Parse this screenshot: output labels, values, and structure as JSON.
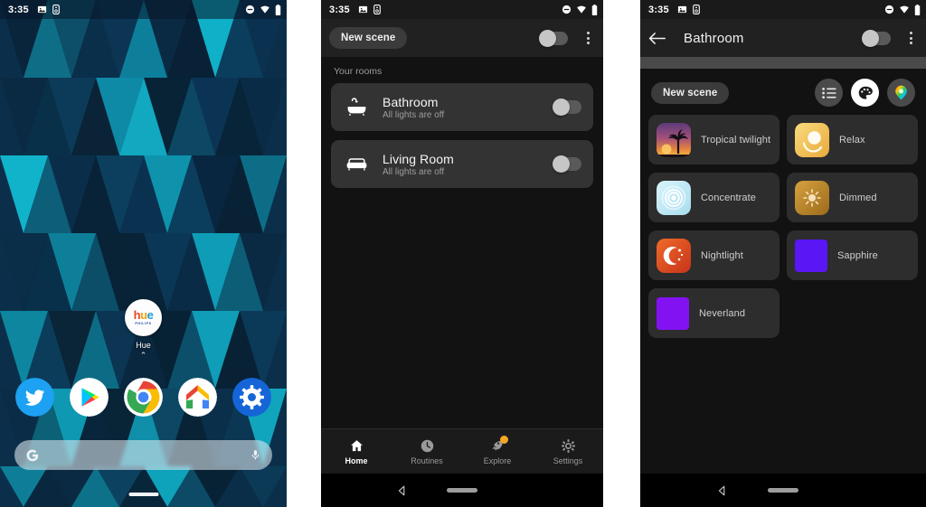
{
  "phones": {
    "launcher": {
      "status": {
        "time": "3:35",
        "left_icons": [
          "image-icon",
          "usb-debug-icon"
        ],
        "right_icons": [
          "do-not-disturb-icon",
          "wifi-icon",
          "battery-icon"
        ]
      },
      "app_shortcut": {
        "label": "Hue",
        "icon_word_a": "h",
        "icon_word_b": "u",
        "icon_word_c": "e",
        "brand": "PHILIPS"
      },
      "page_indicator": "⌃",
      "dock": [
        {
          "name": "twitter-app",
          "label": "Twitter"
        },
        {
          "name": "play-store-app",
          "label": "Play Store"
        },
        {
          "name": "chrome-app",
          "label": "Chrome"
        },
        {
          "name": "google-home-app",
          "label": "Google Home"
        },
        {
          "name": "settings-app",
          "label": "Settings"
        }
      ],
      "search": {
        "placeholder": "",
        "logo": "G",
        "mic": "mic-icon"
      }
    },
    "home": {
      "status": {
        "time": "3:35"
      },
      "appbar": {
        "new_scene": "New scene",
        "toggle_state": "off",
        "menu": "overflow-menu"
      },
      "section_label": "Your rooms",
      "rooms": [
        {
          "name": "Bathroom",
          "subtitle": "All lights are off",
          "icon": "bathtub-icon",
          "toggle_state": "off"
        },
        {
          "name": "Living Room",
          "subtitle": "All lights are off",
          "icon": "sofa-icon",
          "toggle_state": "off"
        }
      ],
      "bottom_nav": [
        {
          "label": "Home",
          "icon": "home-icon",
          "active": true,
          "badge": false
        },
        {
          "label": "Routines",
          "icon": "clock-icon",
          "active": false,
          "badge": false
        },
        {
          "label": "Explore",
          "icon": "rocket-icon",
          "active": false,
          "badge": true
        },
        {
          "label": "Settings",
          "icon": "gear-icon",
          "active": false,
          "badge": false
        }
      ]
    },
    "room": {
      "status": {
        "time": "3:35"
      },
      "appbar": {
        "back": "back-arrow-icon",
        "title": "Bathroom",
        "toggle_state": "off",
        "menu": "overflow-menu"
      },
      "toolbar": {
        "new_scene": "New scene",
        "buttons": [
          {
            "name": "list-view-button",
            "icon": "list-icon",
            "selected": false
          },
          {
            "name": "scenes-button",
            "icon": "palette-icon",
            "selected": true
          },
          {
            "name": "color-picker-button",
            "icon": "color-drop-icon",
            "selected": false
          }
        ]
      },
      "scenes": [
        {
          "name": "Tropical twilight",
          "thumb": "palm-sunset-photo",
          "color": "#6a3f7a"
        },
        {
          "name": "Relax",
          "thumb": "warm-glow-icon",
          "color": "#f2c64e"
        },
        {
          "name": "Concentrate",
          "thumb": "ripple-icon",
          "color": "#bfe9f5"
        },
        {
          "name": "Dimmed",
          "thumb": "sun-icon",
          "color": "#c08a28"
        },
        {
          "name": "Nightlight",
          "thumb": "moon-stars-icon",
          "color": "#d8471d"
        },
        {
          "name": "Sapphire",
          "thumb": "solid-color",
          "color": "#5b16f5"
        },
        {
          "name": "Neverland",
          "thumb": "solid-color",
          "color": "#8312f2"
        }
      ]
    }
  },
  "colors": {
    "accent_badge": "#f5a623",
    "app_background": "#121212",
    "card": "#333333",
    "appbar": "#212121"
  }
}
